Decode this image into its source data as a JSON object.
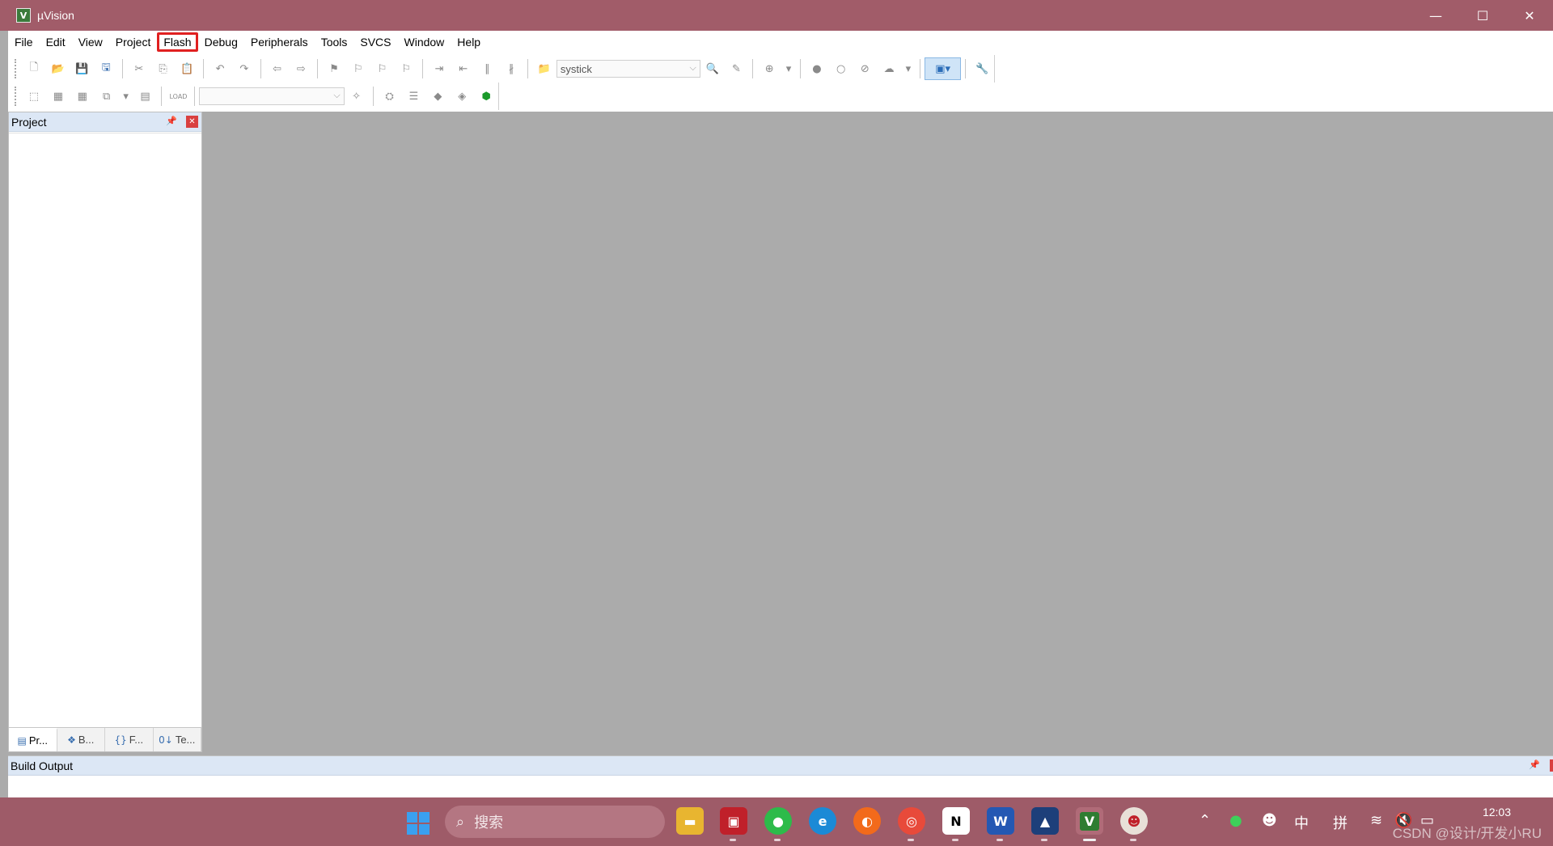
{
  "window": {
    "title": "µVision",
    "minimize_glyph": "—",
    "maximize_glyph": "☐",
    "close_glyph": "✕"
  },
  "menu": {
    "items": [
      "File",
      "Edit",
      "View",
      "Project",
      "Flash",
      "Debug",
      "Peripherals",
      "Tools",
      "SVCS",
      "Window",
      "Help"
    ],
    "highlighted": "Flash"
  },
  "toolbar": {
    "target_combo_value": "systick",
    "target2_combo_value": "",
    "load_label": "LOAD"
  },
  "project_panel": {
    "title": "Project",
    "tabs": [
      {
        "label": "Pr...",
        "icon": "project-tab-icon"
      },
      {
        "label": "B...",
        "icon": "books-tab-icon"
      },
      {
        "label": "F...",
        "icon": "functions-tab-icon",
        "glyph": "{}"
      },
      {
        "label": "Te...",
        "icon": "templates-tab-icon",
        "glyph": "0↓"
      }
    ]
  },
  "build_output": {
    "title": "Build Output"
  },
  "taskbar": {
    "search_placeholder": "搜索",
    "tray_ime_1": "中",
    "tray_ime_2": "拼",
    "clock_time": "12:03",
    "watermark": "CSDN @设计/开发小RU"
  },
  "colors": {
    "titlebar": "#a15c69",
    "taskbar": "#9e5b68",
    "editor_bg": "#ababab",
    "panel_header": "#dce7f5",
    "highlight_outline": "#e02020"
  }
}
